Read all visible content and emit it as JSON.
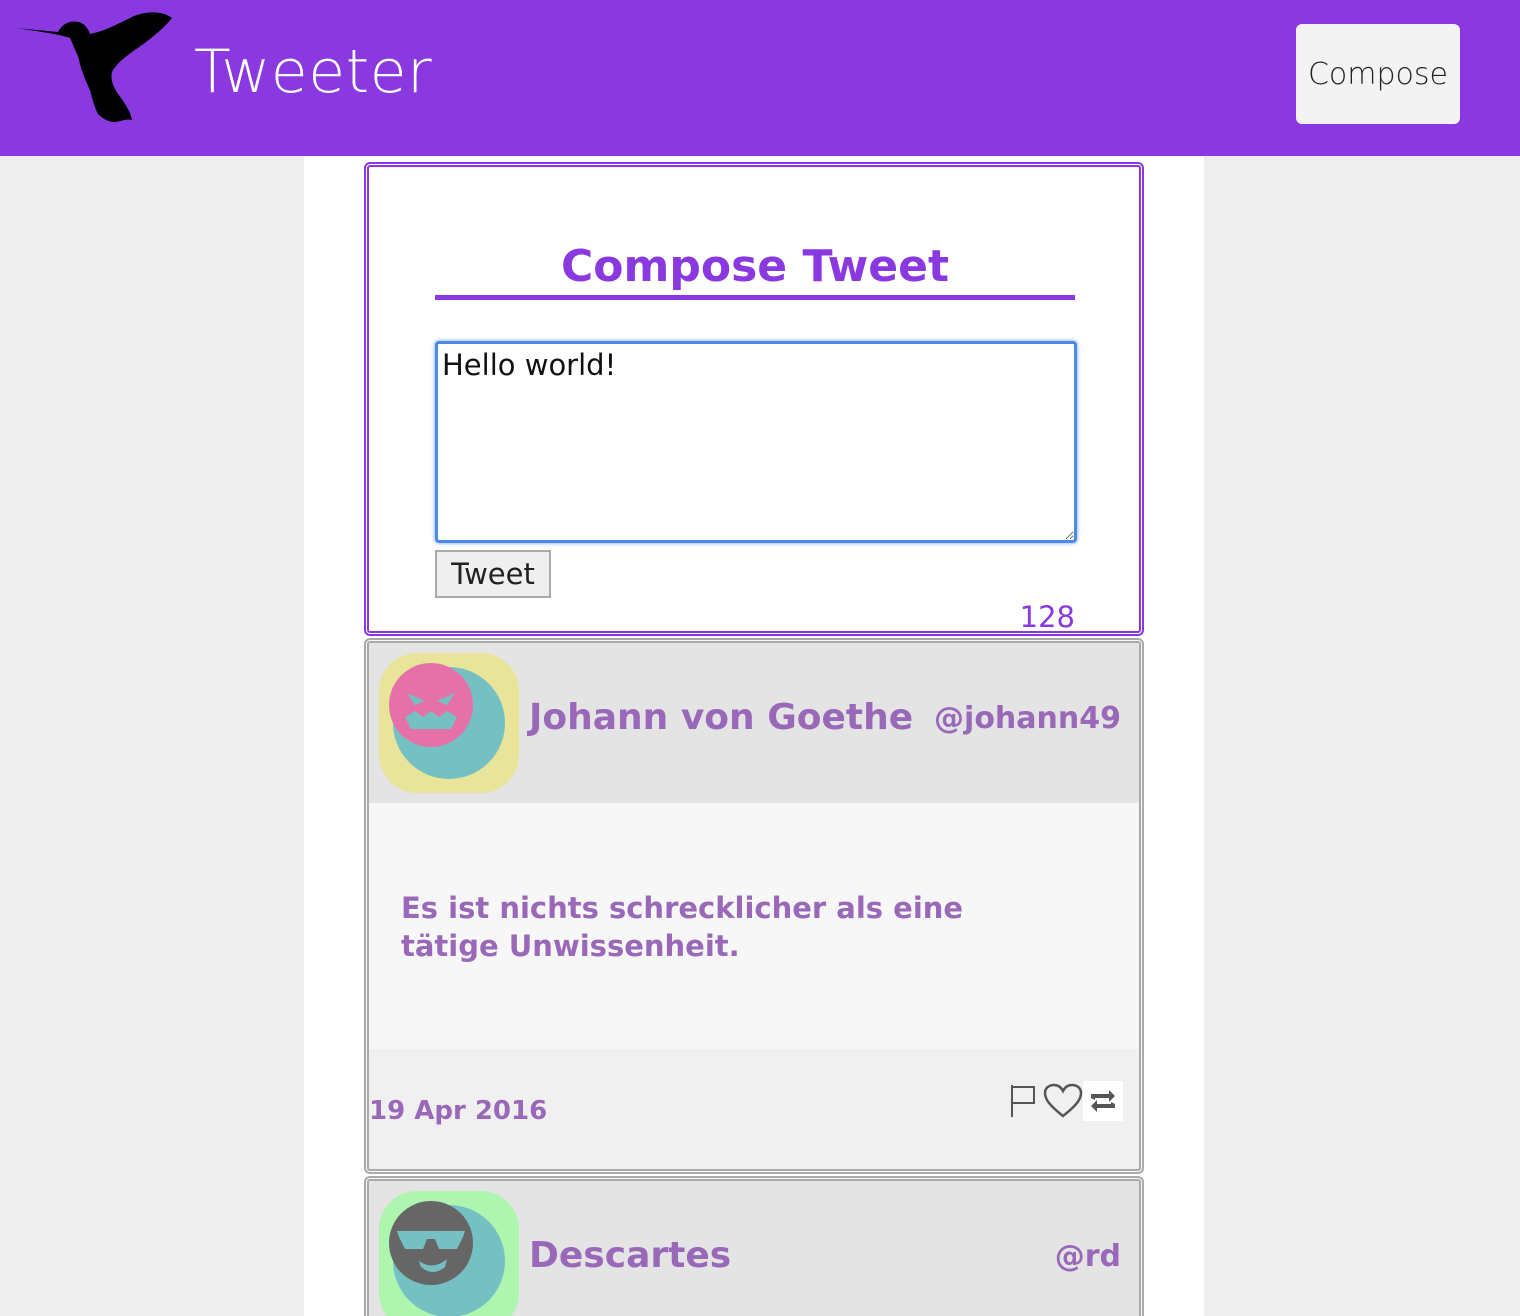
{
  "header": {
    "brand": "Tweeter",
    "compose_label": "Compose",
    "logo_icon": "hummingbird-icon"
  },
  "compose": {
    "title": "Compose Tweet",
    "input_value": "Hello world!",
    "tweet_label": "Tweet",
    "counter": "128"
  },
  "tweets": [
    {
      "name": "Johann von Goethe",
      "handle": "@johann49",
      "text": "Es ist nichts schrecklicher als eine tätige Unwissenheit.",
      "date": "19 Apr 2016",
      "avatar_bg": "#e8e49a",
      "face_color": "#e670a8",
      "actions": [
        "flag-icon",
        "heart-icon",
        "retweet-icon"
      ]
    },
    {
      "name": "Descartes",
      "handle": "@rd",
      "avatar_bg": "#aef5b0",
      "face_color": "#666666"
    }
  ],
  "colors": {
    "accent": "#8a38e0",
    "tweet_text": "#9968b8",
    "page_bg": "#eeeeee"
  }
}
